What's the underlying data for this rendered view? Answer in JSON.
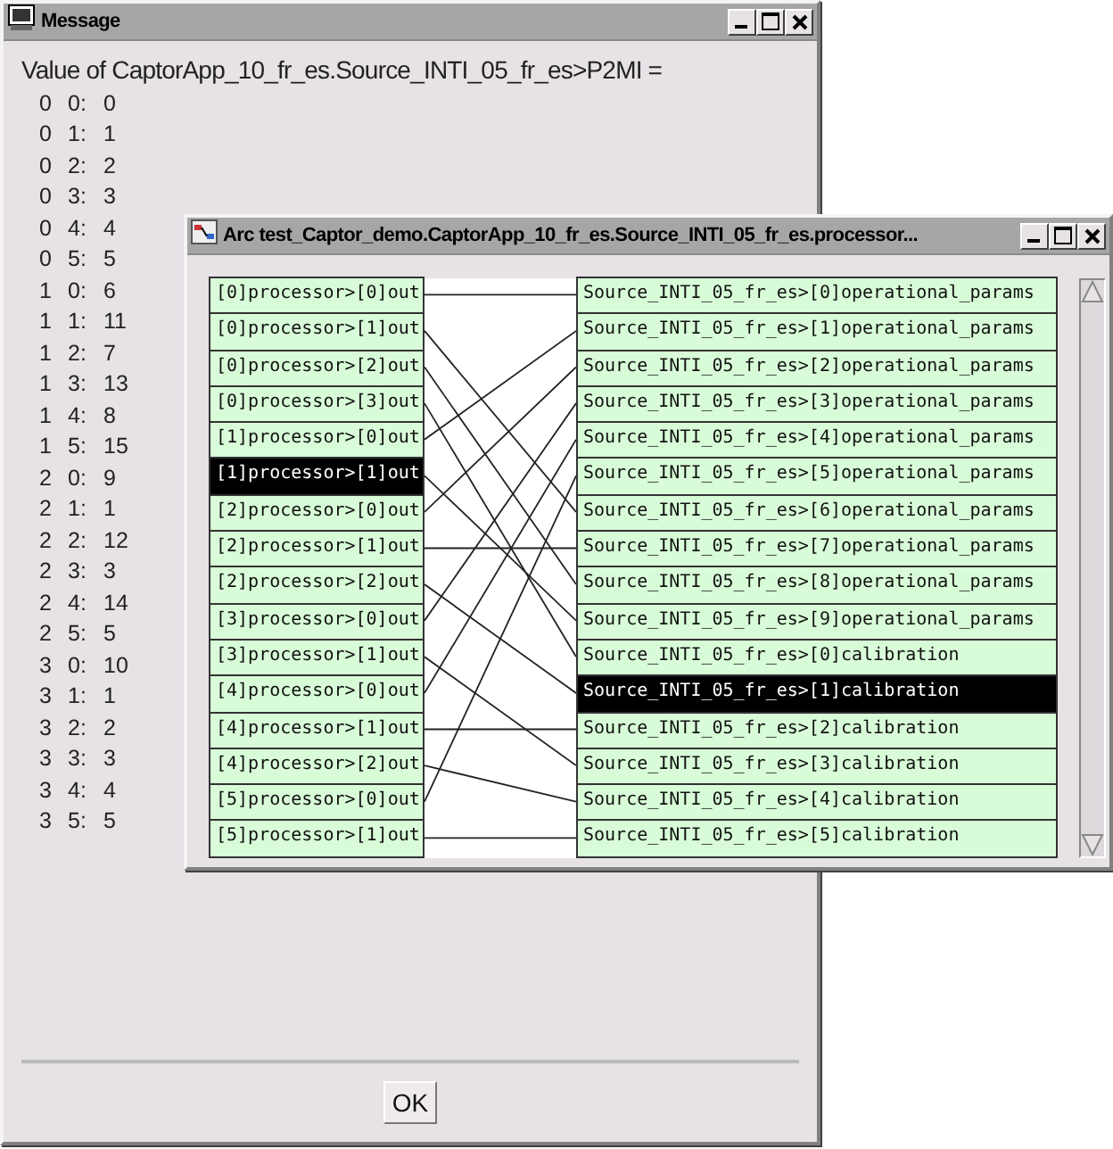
{
  "message_window": {
    "title": "Message",
    "heading": "Value of CaptorApp_10_fr_es.Source_INTI_05_fr_es>P2MI =",
    "rows": [
      [
        "0",
        "0:",
        "0"
      ],
      [
        "0",
        "1:",
        "1"
      ],
      [
        "0",
        "2:",
        "2"
      ],
      [
        "0",
        "3:",
        "3"
      ],
      [
        "0",
        "4:",
        "4"
      ],
      [
        "0",
        "5:",
        "5"
      ],
      [
        "1",
        "0:",
        "6"
      ],
      [
        "1",
        "1:",
        "11"
      ],
      [
        "1",
        "2:",
        "7"
      ],
      [
        "1",
        "3:",
        "13"
      ],
      [
        "1",
        "4:",
        "8"
      ],
      [
        "1",
        "5:",
        "15"
      ],
      [
        "2",
        "0:",
        "9"
      ],
      [
        "2",
        "1:",
        "1"
      ],
      [
        "2",
        "2:",
        "12"
      ],
      [
        "2",
        "3:",
        "3"
      ],
      [
        "2",
        "4:",
        "14"
      ],
      [
        "2",
        "5:",
        "5"
      ],
      [
        "3",
        "0:",
        "10"
      ],
      [
        "3",
        "1:",
        "1"
      ],
      [
        "3",
        "2:",
        "2"
      ],
      [
        "3",
        "3:",
        "3"
      ],
      [
        "3",
        "4:",
        "4"
      ],
      [
        "3",
        "5:",
        "5"
      ]
    ],
    "ok_button": "OK"
  },
  "arc_window": {
    "title": "Arc test_Captor_demo.CaptorApp_10_fr_es.Source_INTI_05_fr_es.processor...",
    "outputs": [
      {
        "label": "[0]processor>[0]out",
        "selected": false
      },
      {
        "label": "[0]processor>[1]out",
        "selected": false
      },
      {
        "label": "[0]processor>[2]out",
        "selected": false
      },
      {
        "label": "[0]processor>[3]out",
        "selected": false
      },
      {
        "label": "[1]processor>[0]out",
        "selected": false
      },
      {
        "label": "[1]processor>[1]out",
        "selected": true
      },
      {
        "label": "[2]processor>[0]out",
        "selected": false
      },
      {
        "label": "[2]processor>[1]out",
        "selected": false
      },
      {
        "label": "[2]processor>[2]out",
        "selected": false
      },
      {
        "label": "[3]processor>[0]out",
        "selected": false
      },
      {
        "label": "[3]processor>[1]out",
        "selected": false
      },
      {
        "label": "[4]processor>[0]out",
        "selected": false
      },
      {
        "label": "[4]processor>[1]out",
        "selected": false
      },
      {
        "label": "[4]processor>[2]out",
        "selected": false
      },
      {
        "label": "[5]processor>[0]out",
        "selected": false
      },
      {
        "label": "[5]processor>[1]out",
        "selected": false
      }
    ],
    "inputs": [
      {
        "label": "Source_INTI_05_fr_es>[0]operational_params",
        "selected": false
      },
      {
        "label": "Source_INTI_05_fr_es>[1]operational_params",
        "selected": false
      },
      {
        "label": "Source_INTI_05_fr_es>[2]operational_params",
        "selected": false
      },
      {
        "label": "Source_INTI_05_fr_es>[3]operational_params",
        "selected": false
      },
      {
        "label": "Source_INTI_05_fr_es>[4]operational_params",
        "selected": false
      },
      {
        "label": "Source_INTI_05_fr_es>[5]operational_params",
        "selected": false
      },
      {
        "label": "Source_INTI_05_fr_es>[6]operational_params",
        "selected": false
      },
      {
        "label": "Source_INTI_05_fr_es>[7]operational_params",
        "selected": false
      },
      {
        "label": "Source_INTI_05_fr_es>[8]operational_params",
        "selected": false
      },
      {
        "label": "Source_INTI_05_fr_es>[9]operational_params",
        "selected": false
      },
      {
        "label": "Source_INTI_05_fr_es>[0]calibration",
        "selected": false
      },
      {
        "label": "Source_INTI_05_fr_es>[1]calibration",
        "selected": true
      },
      {
        "label": "Source_INTI_05_fr_es>[2]calibration",
        "selected": false
      },
      {
        "label": "Source_INTI_05_fr_es>[3]calibration",
        "selected": false
      },
      {
        "label": "Source_INTI_05_fr_es>[4]calibration",
        "selected": false
      },
      {
        "label": "Source_INTI_05_fr_es>[5]calibration",
        "selected": false
      }
    ]
  }
}
